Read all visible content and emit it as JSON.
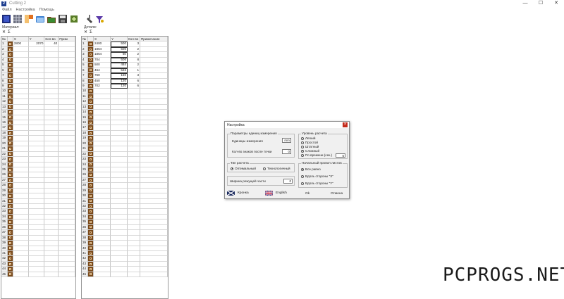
{
  "window": {
    "title": "Cutting 2",
    "icon_letter": "2",
    "controls": [
      "—",
      "☐",
      "✕"
    ]
  },
  "menu": [
    "Файл",
    "Настройка",
    "Помощь"
  ],
  "toolbar": {
    "buttons": [
      "new-icon",
      "grid-icon",
      "palette-icon",
      "open-folder-icon",
      "save-icon",
      "export-icon",
      "tools-icon",
      "calculate-icon"
    ]
  },
  "materials": {
    "label": "Материал:",
    "tools": [
      "✕",
      "Σ"
    ],
    "headers": [
      "№",
      "",
      "X",
      "Y",
      "Кол-во",
      "Прим"
    ],
    "rows": [
      [
        "1",
        "2800",
        "2070",
        "40",
        ""
      ]
    ],
    "row_count": 45
  },
  "details": {
    "label": "Детали:",
    "tools": [
      "✕",
      "Σ"
    ],
    "headers": [
      "№",
      "",
      "X",
      "Y",
      "Кол-во",
      "Примечание"
    ],
    "rows": [
      [
        "1",
        "2400",
        "500",
        "3",
        ""
      ],
      [
        "2",
        "1864",
        "500",
        "2",
        ""
      ],
      [
        "3",
        "1864",
        "60",
        "2",
        ""
      ],
      [
        "4",
        "704",
        "506",
        "8",
        ""
      ],
      [
        "5",
        "500",
        "464",
        "2",
        ""
      ],
      [
        "6",
        "464",
        "546",
        "1",
        ""
      ],
      [
        "7",
        "760",
        "150",
        "3",
        ""
      ],
      [
        "8",
        "450",
        "120",
        "6",
        ""
      ],
      [
        "9",
        "702",
        "120",
        "6",
        ""
      ]
    ],
    "row_count": 45
  },
  "settings_dialog": {
    "title": "Настройка",
    "units_group": {
      "title": "Параметры единиц измерения",
      "unit_label": "Единицы измерения",
      "unit_value": "mm",
      "decimals_label": "Кол-во знаков после точки",
      "decimals_value": "0"
    },
    "level_group": {
      "title": "Уровень расчета",
      "options": [
        "Легкий",
        "Простой",
        "Штатный",
        "Сложный",
        "По времени (сек.)"
      ],
      "selected": "Сложный",
      "time_value": "5"
    },
    "calc_type_group": {
      "title": "Тип расчета",
      "options": [
        "Оптимальный",
        "Технологичный"
      ],
      "selected": "Оптимальный"
    },
    "first_cuts_group": {
      "title": "Начальный пропил листов",
      "options": [
        "Все равно",
        "Вдоль стороны \"X\"",
        "Вдоль стороны \"Y\""
      ],
      "selected": "Все равно"
    },
    "kerf": {
      "label": "Ширина режущей части",
      "value": "0"
    },
    "buttons": {
      "russian": "Кронка",
      "english": "English",
      "ok": "Ok",
      "cancel": "Отмена"
    }
  },
  "watermark": "PCPROGS.NET"
}
